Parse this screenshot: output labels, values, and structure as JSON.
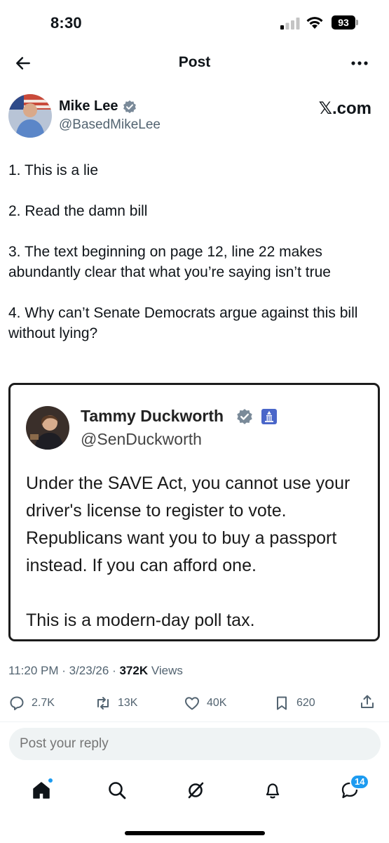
{
  "status_bar": {
    "time": "8:30",
    "battery": "93"
  },
  "header": {
    "title": "Post"
  },
  "author": {
    "name": "Mike Lee",
    "handle": "@BasedMikeLee",
    "source": "𝕏.com"
  },
  "tweet": {
    "paragraphs": [
      "1. This is a lie",
      "2.  Read the damn bill",
      "3. The text beginning on page 12, line 22 makes abundantly clear that what you’re saying isn’t true",
      "4. Why can’t Senate Democrats argue against this bill without lying?"
    ]
  },
  "quote": {
    "name": "Tammy Duckworth",
    "handle": "@SenDuckworth",
    "paragraphs": [
      "Under the SAVE Act, you cannot use your driver's license to register to vote. Republicans want you to buy a passport instead. If you can afford one.",
      "This is a modern-day poll tax."
    ]
  },
  "meta": {
    "time": "11:20 PM",
    "date": "3/23/26",
    "views_count": "372K",
    "views_label": "Views"
  },
  "actions": {
    "replies": "2.7K",
    "reposts": "13K",
    "likes": "40K",
    "bookmarks": "620"
  },
  "reply": {
    "placeholder": "Post your reply"
  },
  "tabs": {
    "messages_badge": "14"
  },
  "colors": {
    "accent": "#1d9bf0",
    "muted": "#536471",
    "verified": "#1d9bf0"
  }
}
